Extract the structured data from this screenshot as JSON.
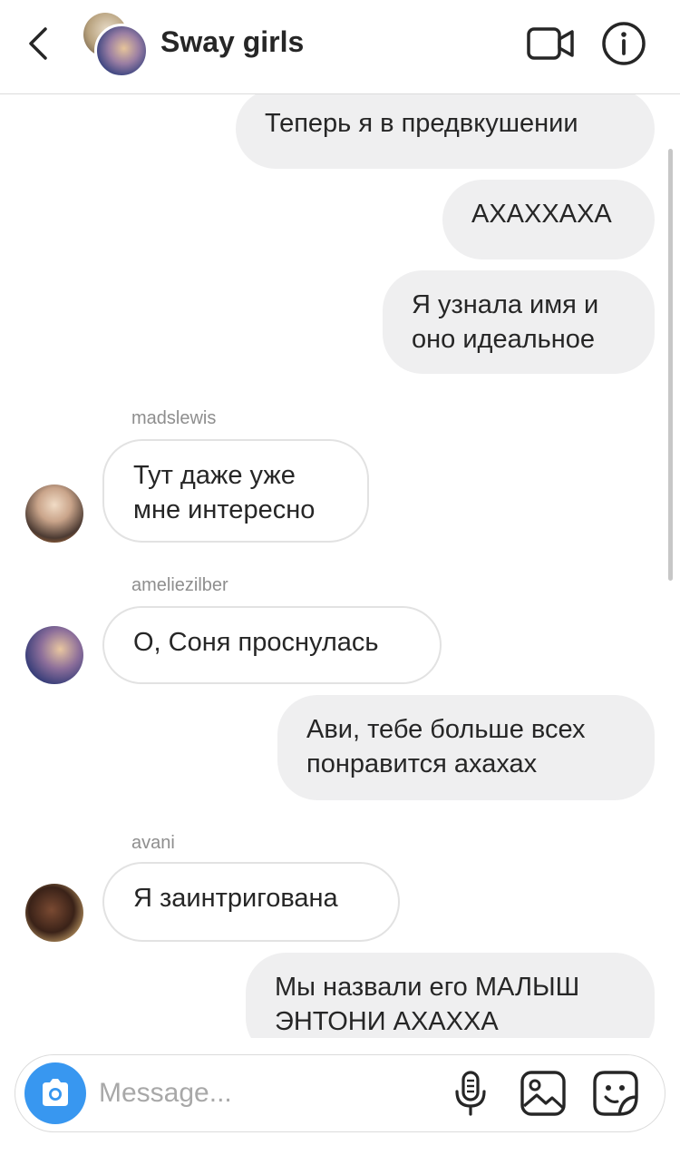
{
  "header": {
    "title": "Sway girls",
    "icons": [
      "chevron-left-icon",
      "video-camera-icon",
      "info-icon"
    ]
  },
  "messages": [
    {
      "direction": "outgoing",
      "text": "Теперь я в предвкушении"
    },
    {
      "direction": "outgoing",
      "text": "АХАХХАХА"
    },
    {
      "direction": "outgoing",
      "lines": [
        "Я узнала имя и",
        "оно идеальное"
      ]
    },
    {
      "direction": "incoming",
      "sender": "madslewis",
      "lines": [
        "Тут даже уже",
        "мне интересно"
      ]
    },
    {
      "direction": "incoming",
      "sender": "ameliezilber",
      "text": "О, Соня проснулась"
    },
    {
      "direction": "outgoing",
      "lines": [
        "Ави, тебе больше всех",
        "понравится ахахах"
      ]
    },
    {
      "direction": "incoming",
      "sender": "avani",
      "text": "Я заинтригована"
    },
    {
      "direction": "outgoing",
      "lines": [
        "Мы назвали его МАЛЫШ",
        "ЭНТОНИ АХАХХА"
      ]
    }
  ],
  "composer": {
    "placeholder": "Message...",
    "icons": [
      "camera-icon",
      "microphone-icon",
      "gallery-icon",
      "sticker-icon"
    ]
  },
  "colors": {
    "accent": "#3897f0",
    "outgoing_bubble": "#efeff0",
    "incoming_border": "#e2e2e2",
    "text": "#262626",
    "secondary_text": "#8e8e8e"
  }
}
